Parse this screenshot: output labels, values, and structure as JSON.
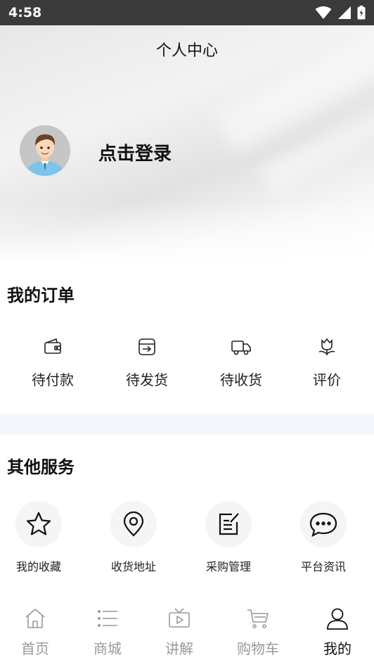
{
  "status_bar": {
    "time": "4:58"
  },
  "header": {
    "title": "个人中心"
  },
  "profile": {
    "login_label": "点击登录"
  },
  "orders": {
    "title": "我的订单",
    "items": [
      {
        "label": "待付款",
        "icon": "wallet-icon"
      },
      {
        "label": "待发货",
        "icon": "ship-box-icon"
      },
      {
        "label": "待收货",
        "icon": "truck-icon"
      },
      {
        "label": "评价",
        "icon": "tulip-icon"
      }
    ]
  },
  "services": {
    "title": "其他服务",
    "items": [
      {
        "label": "我的收藏",
        "icon": "star-icon"
      },
      {
        "label": "收货地址",
        "icon": "location-pin-icon"
      },
      {
        "label": "采购管理",
        "icon": "edit-note-icon"
      },
      {
        "label": "平台资讯",
        "icon": "chat-bubble-icon"
      }
    ]
  },
  "tabbar": {
    "items": [
      {
        "label": "首页",
        "icon": "home-icon",
        "active": false
      },
      {
        "label": "商城",
        "icon": "list-icon",
        "active": false
      },
      {
        "label": "讲解",
        "icon": "tv-icon",
        "active": false
      },
      {
        "label": "购物车",
        "icon": "cart-icon",
        "active": false
      },
      {
        "label": "我的",
        "icon": "user-icon",
        "active": true
      }
    ]
  },
  "colors": {
    "status_bar_bg": "#3a3a3a",
    "inactive_tab": "#999999",
    "active_tab": "#111111",
    "section_band": "#f4f7fb",
    "service_circle": "#f5f5f5"
  }
}
